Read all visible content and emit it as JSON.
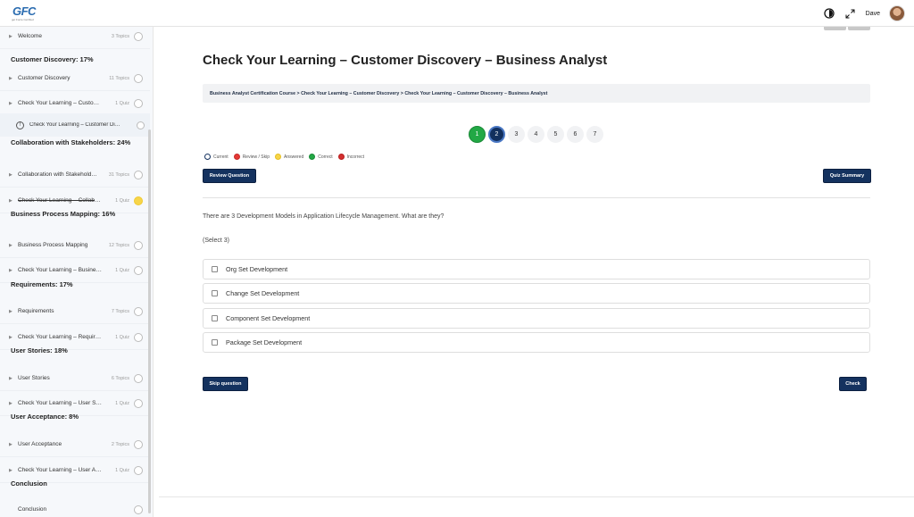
{
  "header": {
    "logo_text": "GFC",
    "logo_tagline": "get Force Certified",
    "user_name": "Dave",
    "icons": [
      "theme-toggle-icon",
      "fullscreen-icon"
    ]
  },
  "sidebar": {
    "items": [
      {
        "type": "lesson",
        "label": "Welcome",
        "meta": "3 Topics",
        "status": "open"
      },
      {
        "type": "section",
        "label": "Customer Discovery: 17%"
      },
      {
        "type": "lesson",
        "label": "Customer Discovery",
        "meta": "11 Topics",
        "status": "open"
      },
      {
        "type": "lesson",
        "label": "Check Your Learning – Custom…",
        "meta": "1 Quiz",
        "status": "open"
      },
      {
        "type": "quiz",
        "label": "Check Your Learning – Customer Di…",
        "status": "open"
      },
      {
        "type": "section",
        "label": "Collaboration with Stakeholders: 24%"
      },
      {
        "type": "lesson",
        "label": "Collaboration with Stakehold…",
        "meta": "31 Topics",
        "status": "open"
      },
      {
        "type": "lesson",
        "label": "Check Your Learning – Collabor…",
        "meta": "1 Quiz",
        "status": "complete"
      },
      {
        "type": "section",
        "label": "Business Process Mapping: 16%"
      },
      {
        "type": "lesson",
        "label": "Business Process Mapping",
        "meta": "12 Topics",
        "status": "open"
      },
      {
        "type": "lesson",
        "label": "Check Your Learning – Busines…",
        "meta": "1 Quiz",
        "status": "open"
      },
      {
        "type": "section",
        "label": "Requirements: 17%"
      },
      {
        "type": "lesson",
        "label": "Requirements",
        "meta": "7 Topics",
        "status": "open"
      },
      {
        "type": "lesson",
        "label": "Check Your Learning – Require…",
        "meta": "1 Quiz",
        "status": "open"
      },
      {
        "type": "section",
        "label": "User Stories: 18%"
      },
      {
        "type": "lesson",
        "label": "User Stories",
        "meta": "6 Topics",
        "status": "open"
      },
      {
        "type": "lesson",
        "label": "Check Your Learning – User Sto…",
        "meta": "1 Quiz",
        "status": "open"
      },
      {
        "type": "section",
        "label": "User Acceptance: 8%"
      },
      {
        "type": "lesson",
        "label": "User Acceptance",
        "meta": "2 Topics",
        "status": "open"
      },
      {
        "type": "lesson",
        "label": "Check Your Learning – User Ac…",
        "meta": "1 Quiz",
        "status": "open"
      },
      {
        "type": "section",
        "label": "Conclusion"
      },
      {
        "type": "lesson-plain",
        "label": "Conclusion",
        "meta": "",
        "status": "open"
      }
    ]
  },
  "main": {
    "title": "Check Your Learning – Customer Discovery – Business Analyst",
    "breadcrumb": "Business Analyst Certification Course > Check Your Learning – Customer Discovery > Check Your Learning – Customer Discovery – Business Analyst",
    "pager": [
      {
        "label": "1",
        "state": "correct"
      },
      {
        "label": "2",
        "state": "current"
      },
      {
        "label": "3",
        "state": ""
      },
      {
        "label": "4",
        "state": ""
      },
      {
        "label": "5",
        "state": ""
      },
      {
        "label": "6",
        "state": ""
      },
      {
        "label": "7",
        "state": ""
      }
    ],
    "legend": [
      {
        "label": "Current",
        "color": "#ffffff",
        "border": "#12305e"
      },
      {
        "label": "Review / Skip",
        "color": "#e53935",
        "border": "#c62828"
      },
      {
        "label": "Answered",
        "color": "#f7d54a",
        "border": "#e6bf20"
      },
      {
        "label": "Correct",
        "color": "#22a845",
        "border": "#198936"
      },
      {
        "label": "Incorrect",
        "color": "#d32f2f",
        "border": "#b71c1c"
      }
    ],
    "review_button": "Review Question",
    "summary_button": "Quiz Summary",
    "question": "There are 3 Development Models in Application Lifecycle Management. What are they?",
    "select_hint": "(Select 3)",
    "answers": [
      "Org Set Development",
      "Change Set Development",
      "Component Set Development",
      "Package Set Development"
    ],
    "skip_button": "Skip question",
    "check_button": "Check"
  }
}
